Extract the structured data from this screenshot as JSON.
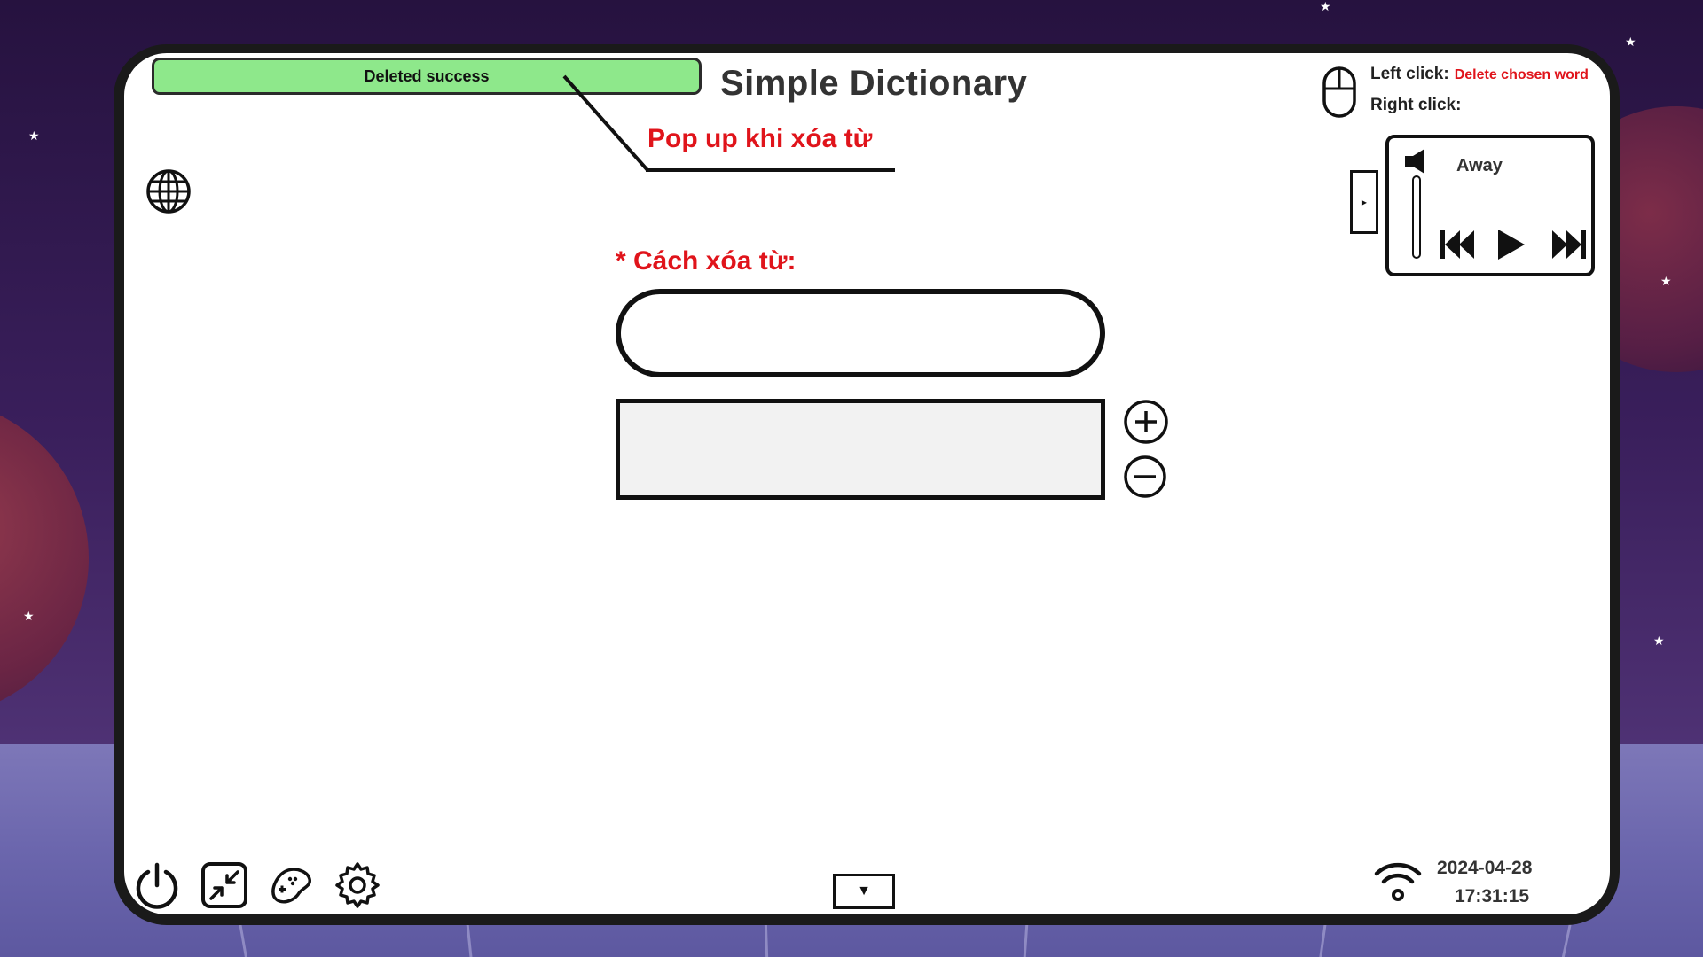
{
  "notification": {
    "text": "Deleted success",
    "color": "#8ee88b"
  },
  "app": {
    "title": "Simple Dictionary"
  },
  "annotation": {
    "text": "Pop up khi xóa từ",
    "color": "#e0141b"
  },
  "mouse_hints": {
    "left_label": "Left click:",
    "left_value": "Delete chosen word",
    "right_label": "Right click:",
    "right_value": ""
  },
  "music_player": {
    "song_title": "Away",
    "icons": [
      "volume-icon",
      "previous-track-icon",
      "play-icon",
      "next-track-icon"
    ]
  },
  "main": {
    "section_label": "* Cách xóa từ:",
    "word_input": {
      "value": "",
      "placeholder": ""
    }
  },
  "bottom_bar": {
    "icons": [
      "power-icon",
      "resize-icon",
      "gamepad-icon",
      "settings-icon"
    ],
    "dropdown_symbol": "▼"
  },
  "status": {
    "date": "2024-04-28",
    "time": "17:31:15"
  },
  "colors": {
    "accent_red": "#e0141b",
    "frame": "#1a1a1a",
    "background": "#3a1f5c"
  }
}
